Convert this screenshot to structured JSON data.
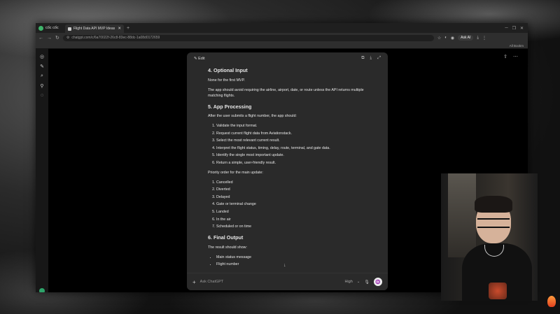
{
  "browser": {
    "brand": "cốc cốc",
    "tab_title": "Flight Data API MVP Ideas",
    "new_tab": "+",
    "url": "chatgpt.com/c/6a70022f-26c8-83ec-88dc-1a08d0172659",
    "ask_ai": "Ask AI",
    "bookmarks_label": "All Bookm"
  },
  "editor": {
    "edit_label": "Edit",
    "sections": [
      {
        "heading": "4. Optional Input"
      },
      {
        "heading": "5. App Processing"
      },
      {
        "heading": "6. Final Output"
      }
    ],
    "p_none": "None for the first MVP.",
    "p_avoid": "The app should avoid requiring the airline, airport, date, or route unless the API returns multiple matching flights.",
    "p_after": "After the user submits a flight number, the app should:",
    "steps": [
      "Validate the input format.",
      "Request current flight data from Aviationstack.",
      "Select the most relevant current result.",
      "Interpret the flight status, timing, delay, route, terminal, and gate data.",
      "Identify the single most important update.",
      "Return a simple, user-friendly result."
    ],
    "p_priority": "Priority order for the main update:",
    "priorities": [
      "Cancelled",
      "Diverted",
      "Delayed",
      "Gate or terminal change",
      "Landed",
      "In the air",
      "Scheduled or on time"
    ],
    "p_result": "The result should show:",
    "result_items": [
      "Main status message",
      "Flight number"
    ]
  },
  "composer": {
    "placeholder": "Ask ChatGPT",
    "model": "High"
  }
}
